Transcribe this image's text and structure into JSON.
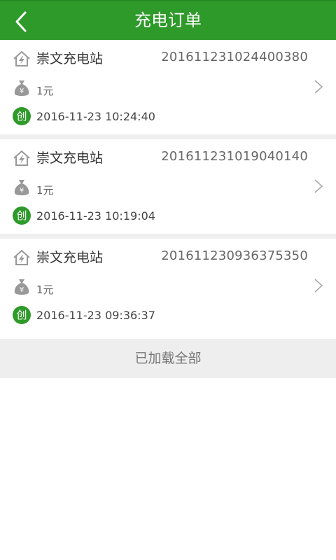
{
  "header": {
    "title": "充电订单"
  },
  "orders": [
    {
      "station": "崇文充电站",
      "order_no": "2016112310244003​80",
      "amount": "1元",
      "created_badge": "创",
      "created_time": "2016-11-23 10:24:40"
    },
    {
      "station": "崇文充电站",
      "order_no": "201611231019040140",
      "amount": "1元",
      "created_badge": "创",
      "created_time": "2016-11-23 10:19:04"
    },
    {
      "station": "崇文充电站",
      "order_no": "201611230936375350",
      "amount": "1元",
      "created_badge": "创",
      "created_time": "2016-11-23 09:36:37"
    }
  ],
  "footer": {
    "load_all": "已加载全部"
  },
  "colors": {
    "brand": "#2e9a2a",
    "separator": "#efefef",
    "footer_bg": "#eeeeee"
  },
  "icons": {
    "back": "chevron-left-icon",
    "station": "house-bolt-icon",
    "money": "money-bag-icon",
    "detail": "chevron-right-icon"
  }
}
